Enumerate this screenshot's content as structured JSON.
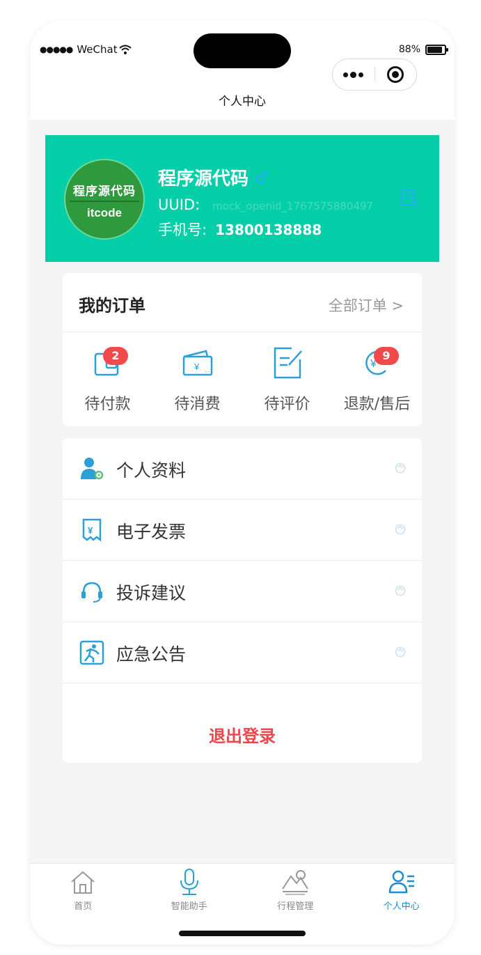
{
  "status_bar": {
    "carrier": "WeChat",
    "battery": "88%",
    "battery_level": 0.88
  },
  "nav": {
    "title": "个人中心"
  },
  "profile": {
    "avatar_top": "程序源代码",
    "avatar_bottom": "itcode",
    "name": "程序源代码",
    "gender_symbol": "♂",
    "uuid_label": "UUID:",
    "uuid_value": "mock_openid_1767575880497",
    "phone_label": "手机号:",
    "phone_value": "13800138888",
    "edit_icon": "edit-document-icon"
  },
  "orders": {
    "title": "我的订单",
    "all_link": "全部订单 >",
    "items": [
      {
        "label": "待付款",
        "badge": "2",
        "icon": "wallet-icon"
      },
      {
        "label": "待消费",
        "badge": "",
        "icon": "ticket-icon"
      },
      {
        "label": "待评价",
        "badge": "",
        "icon": "review-icon"
      },
      {
        "label": "退款/售后",
        "badge": "9",
        "icon": "refund-icon"
      }
    ]
  },
  "menu": {
    "items": [
      {
        "label": "个人资料",
        "icon": "user-settings-icon"
      },
      {
        "label": "电子发票",
        "icon": "invoice-icon"
      },
      {
        "label": "投诉建议",
        "icon": "headset-icon"
      },
      {
        "label": "应急公告",
        "icon": "emergency-exit-icon"
      }
    ],
    "logout": "退出登录"
  },
  "tabbar": {
    "items": [
      {
        "label": "首页",
        "icon": "home-icon"
      },
      {
        "label": "智能助手",
        "icon": "microphone-icon"
      },
      {
        "label": "行程管理",
        "icon": "mountain-icon"
      },
      {
        "label": "个人中心",
        "icon": "user-list-icon",
        "active": true
      }
    ]
  },
  "colors": {
    "primary": "#04cfa8",
    "accent": "#1a8cd8",
    "badge": "#f24a4a",
    "logout": "#f2444a"
  }
}
